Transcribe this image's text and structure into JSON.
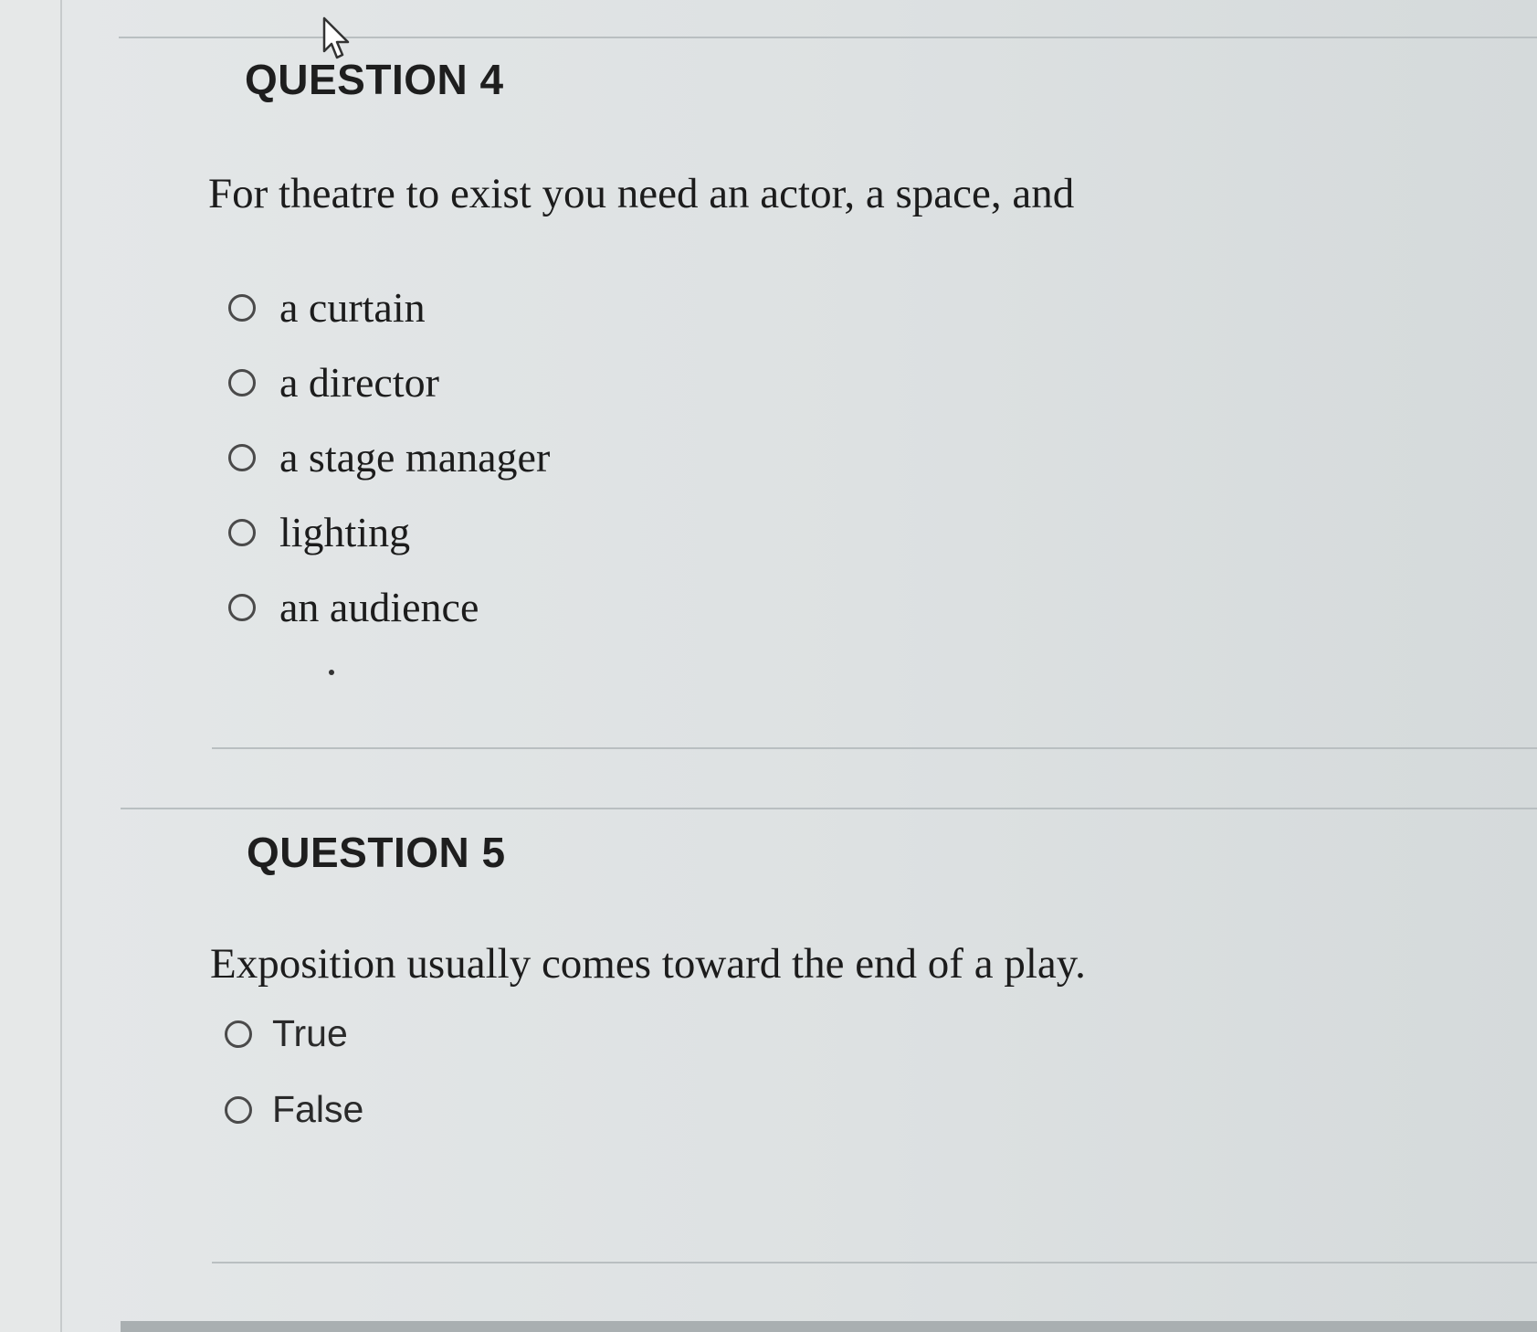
{
  "question4": {
    "title": "QUESTION 4",
    "text": "For theatre to exist you need an actor, a space, and",
    "options": [
      {
        "label": "a curtain",
        "selected": false
      },
      {
        "label": "a director",
        "selected": false
      },
      {
        "label": "a stage manager",
        "selected": false
      },
      {
        "label": "lighting",
        "selected": false
      },
      {
        "label": "an audience",
        "selected": false
      }
    ]
  },
  "question5": {
    "title": "QUESTION 5",
    "text": "Exposition usually comes toward the end of a play.",
    "options": [
      {
        "label": "True",
        "selected": false
      },
      {
        "label": "False",
        "selected": false
      }
    ]
  }
}
